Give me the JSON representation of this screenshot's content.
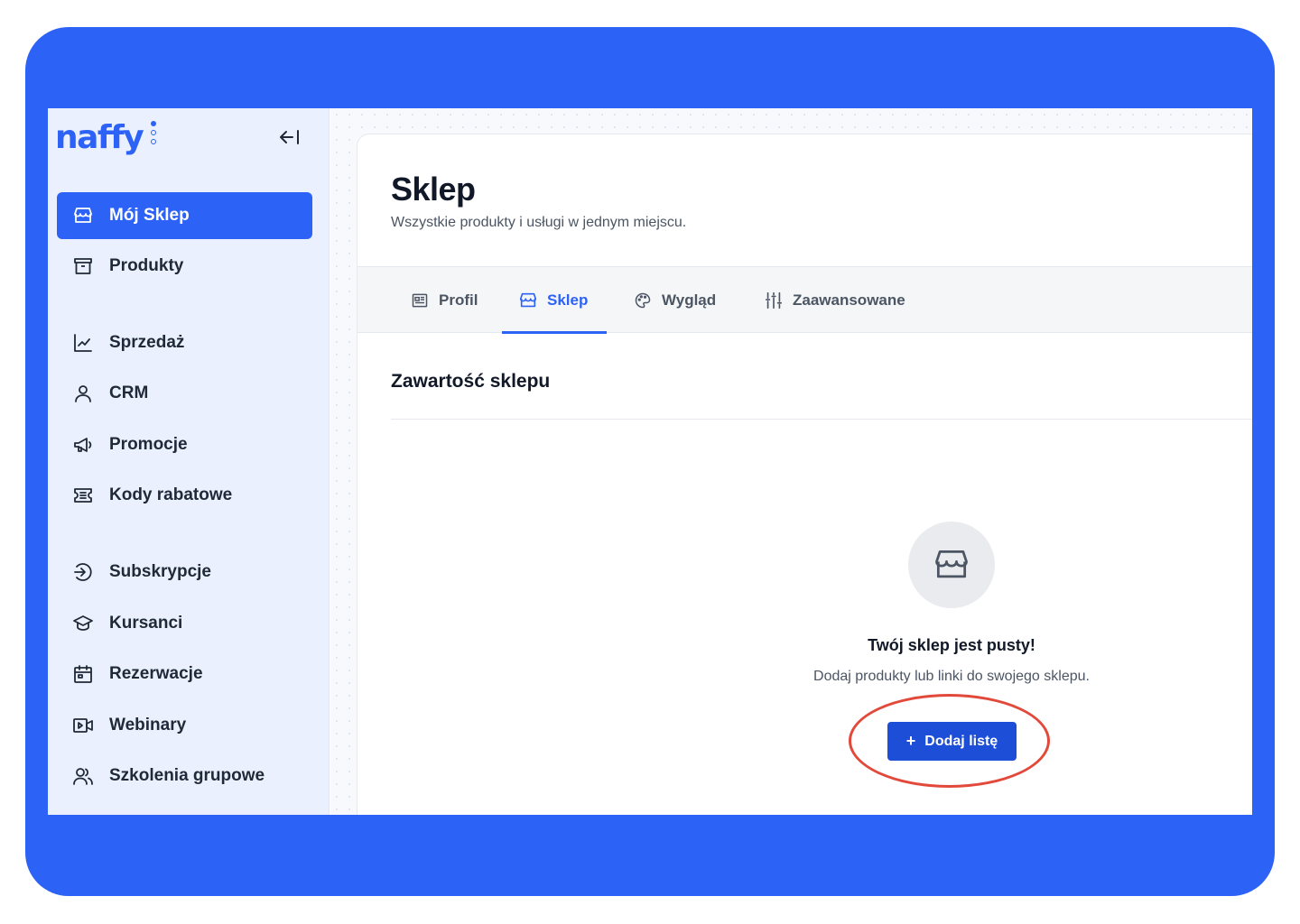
{
  "brand": {
    "logo_text": "naffy"
  },
  "sidebar": {
    "items": [
      {
        "label": "Mój Sklep",
        "icon": "store-icon",
        "active": true
      },
      {
        "label": "Produkty",
        "icon": "box-icon",
        "active": false
      },
      {
        "label": "Sprzedaż",
        "icon": "chart-line-icon",
        "active": false
      },
      {
        "label": "CRM",
        "icon": "user-icon",
        "active": false
      },
      {
        "label": "Promocje",
        "icon": "megaphone-icon",
        "active": false
      },
      {
        "label": "Kody rabatowe",
        "icon": "ticket-icon",
        "active": false
      },
      {
        "label": "Subskrypcje",
        "icon": "subscription-icon",
        "active": false
      },
      {
        "label": "Kursanci",
        "icon": "graduation-cap-icon",
        "active": false
      },
      {
        "label": "Rezerwacje",
        "icon": "calendar-icon",
        "active": false
      },
      {
        "label": "Webinary",
        "icon": "video-icon",
        "active": false
      },
      {
        "label": "Szkolenia grupowe",
        "icon": "users-icon",
        "active": false
      }
    ]
  },
  "page": {
    "title": "Sklep",
    "subtitle": "Wszystkie produkty i usługi w jednym miejscu."
  },
  "tabs": [
    {
      "label": "Profil",
      "icon": "profile-card-icon",
      "active": false
    },
    {
      "label": "Sklep",
      "icon": "store-icon",
      "active": true
    },
    {
      "label": "Wygląd",
      "icon": "palette-icon",
      "active": false
    },
    {
      "label": "Zaawansowane",
      "icon": "sliders-icon",
      "active": false
    }
  ],
  "content": {
    "section_title": "Zawartość sklepu",
    "empty_title": "Twój sklep jest pusty!",
    "empty_description": "Dodaj produkty lub linki do swojego sklepu.",
    "add_button_label": "Dodaj listę",
    "add_button_symbol": "+"
  },
  "colors": {
    "brand_blue": "#2d62f6",
    "button_blue": "#1d4ed8",
    "highlight_red": "#e2493a"
  }
}
